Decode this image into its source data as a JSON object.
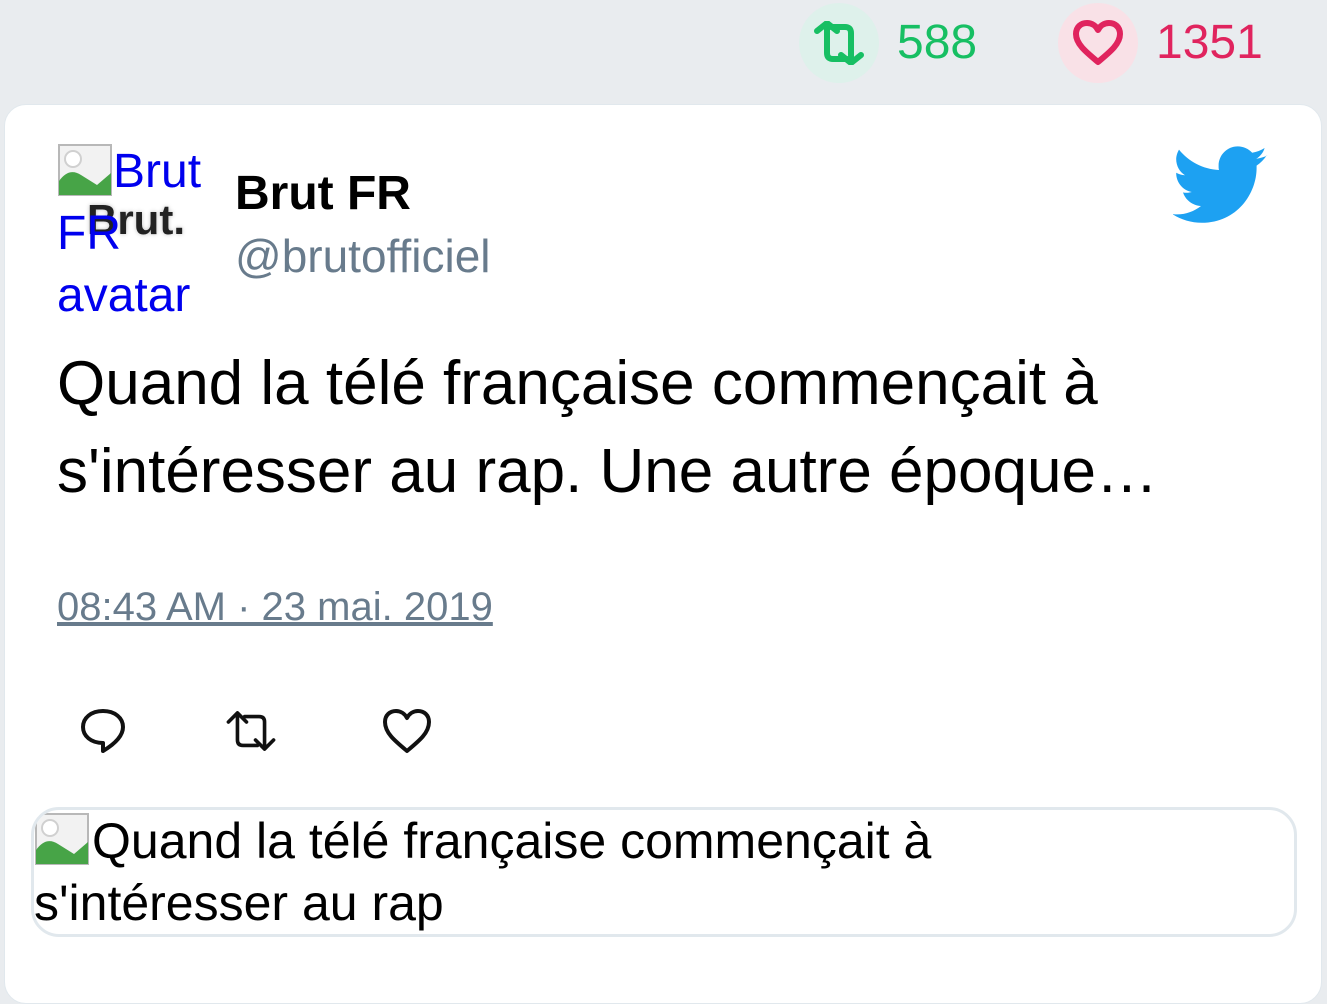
{
  "stats": {
    "retweets": "588",
    "likes": "1351",
    "retweet_color": "#17bf63",
    "like_color": "#e0245e"
  },
  "tweet": {
    "avatar_alt": "Brut FR avatar",
    "avatar_logo_text": "Brut.",
    "display_name": "Brut FR",
    "handle": "@brutofficiel",
    "text": "Quand la télé française commençait à s'intéresser au rap. Une autre époque…",
    "timestamp": "08:43 AM · 23 mai. 2019",
    "brand_icon": "twitter-bird-icon",
    "brand_color": "#1da1f2"
  },
  "actions": {
    "reply_icon": "reply-icon",
    "retweet_icon": "retweet-icon",
    "like_icon": "heart-icon"
  },
  "media": {
    "alt_text": "Quand la télé française commençait à s'intéresser au rap"
  }
}
